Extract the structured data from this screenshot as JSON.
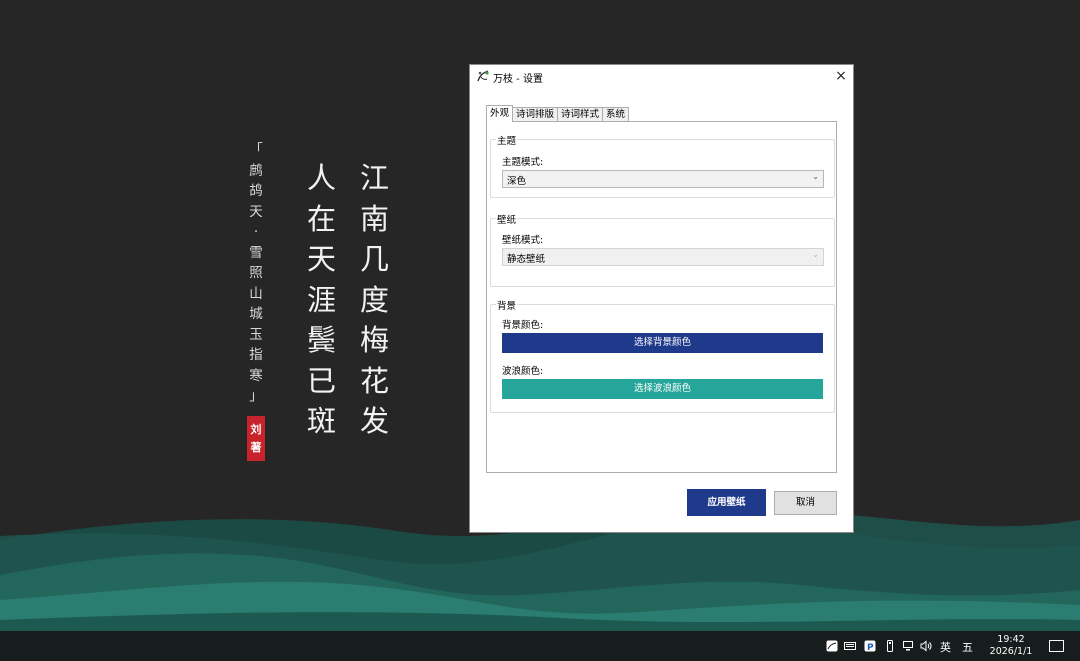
{
  "poem": {
    "columns": [
      [
        "江",
        "南",
        "几",
        "度",
        "梅",
        "花",
        "发"
      ],
      [
        "人",
        "在",
        "天",
        "涯",
        "鬓",
        "已",
        "斑"
      ]
    ],
    "title_chars": [
      "「",
      "鹧",
      "鸪",
      "天",
      "·",
      "雪",
      "照",
      "山",
      "城",
      "玉",
      "指",
      "寒",
      "」"
    ],
    "seal": [
      "刘",
      "著"
    ]
  },
  "dialog": {
    "title": "万枝 - 设置",
    "close": "×",
    "tabs": [
      "外观",
      "诗词排版",
      "诗词样式",
      "系统"
    ],
    "active_tab": 0,
    "theme": {
      "legend": "主题",
      "label": "主题模式:",
      "value": "深色"
    },
    "wallpaper": {
      "legend": "壁纸",
      "label": "壁纸模式:",
      "value": "静态壁纸",
      "disabled": true
    },
    "background": {
      "legend": "背景",
      "bg_label": "背景颜色:",
      "bg_button": "选择背景颜色",
      "bg_color": "#1f3a8a",
      "wave_label": "波浪颜色:",
      "wave_button": "选择波浪颜色",
      "wave_color": "#26a69a"
    },
    "apply": "应用壁纸",
    "cancel": "取消"
  },
  "taskbar": {
    "ime": "英",
    "ime_mode": "五",
    "time": "19:42",
    "date": "2026/1/1"
  },
  "colors": {
    "desktop_bg": "#262626",
    "wave_light": "#2a7a6d",
    "wave_mid": "#215e55",
    "wave_dark": "#17403b",
    "taskbar": "#161d1c",
    "seal": "#c8222a"
  }
}
